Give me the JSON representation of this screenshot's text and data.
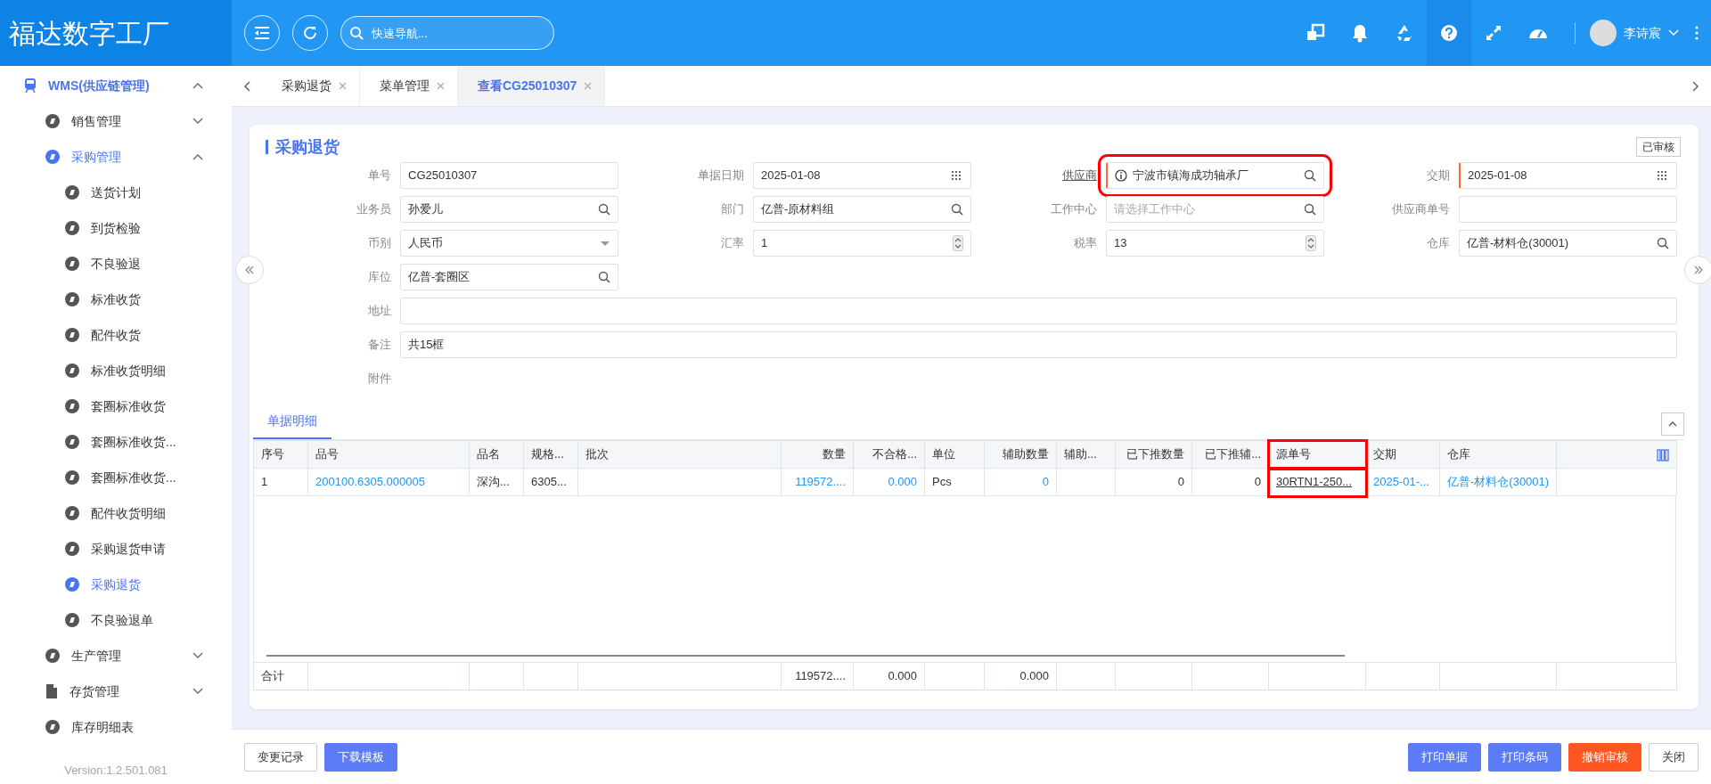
{
  "app": {
    "title": "福达数字工厂"
  },
  "header": {
    "search_placeholder": "快速导航...",
    "user": "李诗宸"
  },
  "sidebar": {
    "items": [
      {
        "label": "WMS(供应链管理)",
        "kind": "train",
        "expanded": true,
        "selected": true,
        "children": [
          {
            "label": "销售管理",
            "kind": "disc",
            "expanded": false,
            "selected": false
          },
          {
            "label": "采购管理",
            "kind": "disc",
            "expanded": true,
            "selected": true,
            "children": [
              {
                "label": "送货计划",
                "selected": false
              },
              {
                "label": "到货检验",
                "selected": false
              },
              {
                "label": "不良验退",
                "selected": false
              },
              {
                "label": "标准收货",
                "selected": false
              },
              {
                "label": "配件收货",
                "selected": false
              },
              {
                "label": "标准收货明细",
                "selected": false
              },
              {
                "label": "套圈标准收货",
                "selected": false
              },
              {
                "label": "套圈标准收货...",
                "selected": false
              },
              {
                "label": "套圈标准收货...",
                "selected": false
              },
              {
                "label": "配件收货明细",
                "selected": false
              },
              {
                "label": "采购退货申请",
                "selected": false
              },
              {
                "label": "采购退货",
                "selected": true
              },
              {
                "label": "不良验退单",
                "selected": false
              }
            ]
          },
          {
            "label": "生产管理",
            "kind": "disc",
            "expanded": false,
            "selected": false
          },
          {
            "label": "存货管理",
            "kind": "file",
            "expanded": false,
            "selected": false
          },
          {
            "label": "库存明细表",
            "kind": "disc",
            "selected": false
          }
        ]
      }
    ],
    "version": "Version:1.2.501.081"
  },
  "tabs": [
    {
      "label": "采购退货",
      "selected": false
    },
    {
      "label": "菜单管理",
      "selected": false
    },
    {
      "label": "查看CG25010307",
      "selected": true
    }
  ],
  "form": {
    "title": "采购退货",
    "status": "已审核",
    "fields": [
      {
        "label": "单号",
        "kind": "text",
        "value": "CG25010307"
      },
      {
        "label": "单据日期",
        "kind": "date",
        "value": "2025-01-08"
      },
      {
        "label": "供应商",
        "kind": "lookup",
        "value": "宁波市镇海成功轴承厂",
        "required": true,
        "highlighted": true,
        "link": true,
        "info": true
      },
      {
        "label": "交期",
        "kind": "date",
        "value": "2025-01-08",
        "required": true
      },
      {
        "label": "业务员",
        "kind": "lookup",
        "value": "孙爱儿"
      },
      {
        "label": "部门",
        "kind": "lookup",
        "value": "亿普-原材料组"
      },
      {
        "label": "工作中心",
        "kind": "lookup",
        "placeholder": "请选择工作中心"
      },
      {
        "label": "供应商单号",
        "kind": "text"
      },
      {
        "label": "币别",
        "kind": "select",
        "value": "人民币"
      },
      {
        "label": "汇率",
        "kind": "number",
        "value": "1"
      },
      {
        "label": "税率",
        "kind": "number",
        "value": "13"
      },
      {
        "label": "仓库",
        "kind": "lookup",
        "value": "亿普-材料仓(30001)"
      },
      {
        "label": "库位",
        "kind": "lookup",
        "value": "亿普-套圈区"
      },
      {
        "label": "地址",
        "kind": "wide"
      },
      {
        "label": "备注",
        "kind": "wide",
        "value": "共15框"
      },
      {
        "label": "附件",
        "kind": "label"
      }
    ]
  },
  "details": {
    "tab": "单据明细",
    "columns": [
      {
        "label": "序号",
        "kind": "text",
        "total": "合计"
      },
      {
        "label": "品号",
        "kind": "text"
      },
      {
        "label": "品名",
        "kind": "text"
      },
      {
        "label": "规格...",
        "kind": "text"
      },
      {
        "label": "批次",
        "kind": "text"
      },
      {
        "label": "数量",
        "kind": "number",
        "total": "119572...."
      },
      {
        "label": "不合格...",
        "kind": "number",
        "total": "0.000"
      },
      {
        "label": "单位",
        "kind": "text"
      },
      {
        "label": "辅助数量",
        "kind": "number",
        "total": "0.000"
      },
      {
        "label": "辅助...",
        "kind": "text"
      },
      {
        "label": "已下推数量",
        "kind": "number"
      },
      {
        "label": "已下推辅...",
        "kind": "number"
      },
      {
        "label": "源单号",
        "kind": "text",
        "highlighted": true
      },
      {
        "label": "交期",
        "kind": "text"
      },
      {
        "label": "仓库",
        "kind": "text"
      },
      {
        "kind": "settings"
      }
    ],
    "rows": [
      [
        {
          "text": "1"
        },
        {
          "text": "200100.6305.000005",
          "kind": "link"
        },
        {
          "text": "深沟..."
        },
        {
          "text": "6305..."
        },
        null,
        {
          "text": "119572....",
          "kind": "link"
        },
        {
          "text": "0.000",
          "kind": "link"
        },
        {
          "text": "Pcs"
        },
        {
          "text": "0",
          "kind": "link"
        },
        null,
        {
          "text": "0"
        },
        {
          "text": "0"
        },
        {
          "text": "30RTN1-250...",
          "kind": "underline"
        },
        {
          "text": "2025-01-...",
          "kind": "link"
        },
        {
          "text": "亿普-材料仓(30001)",
          "kind": "link"
        },
        null
      ]
    ]
  },
  "buttons_left": [
    {
      "label": "变更记录",
      "kind": "outline"
    },
    {
      "label": "下载模板",
      "kind": "primary"
    }
  ],
  "buttons_right": [
    {
      "label": "打印单据",
      "kind": "primary"
    },
    {
      "label": "打印条码",
      "kind": "primary"
    },
    {
      "label": "撤销审核",
      "kind": "danger"
    },
    {
      "label": "关闭",
      "kind": "outline"
    }
  ]
}
